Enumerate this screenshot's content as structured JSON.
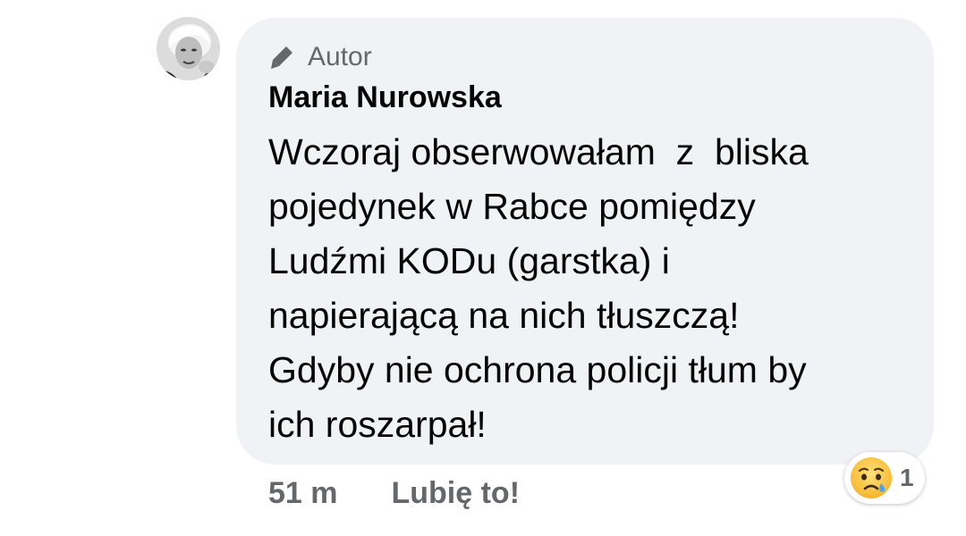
{
  "comment": {
    "badge": {
      "icon": "pencil-icon",
      "label": "Autor"
    },
    "author": {
      "name": "Maria Nurowska",
      "avatar_icon": "profile-photo"
    },
    "text_lines": [
      "Wczoraj obserwowałam  z  bliska",
      "pojedynek w Rabce pomiędzy",
      "Ludźmi KODu (garstka) i",
      "napierającą na nich tłuszczą!",
      "Gdyby nie ochrona policji tłum by",
      "ich roszarpał!"
    ],
    "timestamp": "51 m",
    "like_label": "Lubię to!",
    "reaction": {
      "icon": "sad-crying-emoji-icon",
      "count": "1"
    }
  },
  "colors": {
    "bubble_background": "#f0f2f5",
    "primary_text": "#050505",
    "secondary_text": "#65676b"
  }
}
